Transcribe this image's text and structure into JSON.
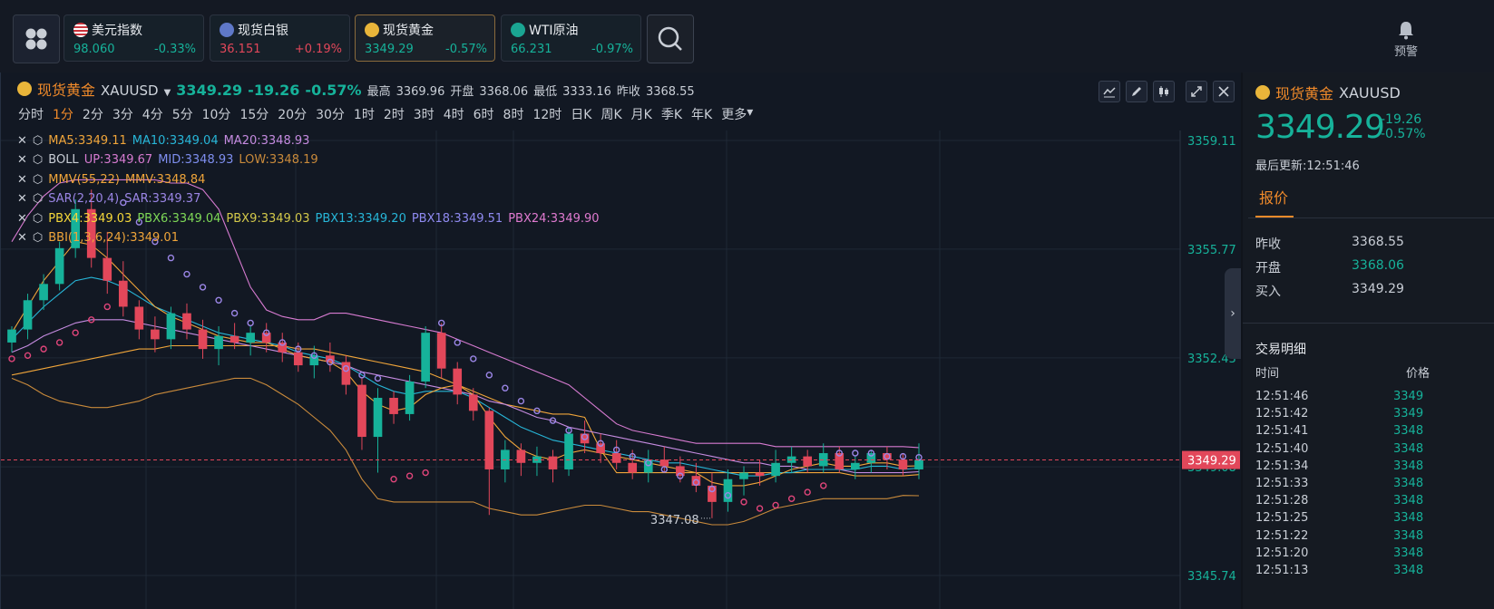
{
  "topbar": {
    "tickers": [
      {
        "name": "美元指数",
        "price": "98.060",
        "change": "-0.33%",
        "icon": "us-flag-icon"
      },
      {
        "name": "现货白银",
        "price": "36.151",
        "change": "+0.19%",
        "icon": "silver-icon"
      },
      {
        "name": "现货黄金",
        "price": "3349.29",
        "change": "-0.57%",
        "icon": "gold-icon"
      },
      {
        "name": "WTI原油",
        "price": "66.231",
        "change": "-0.97%",
        "icon": "oil-icon"
      }
    ],
    "alert_label": "预警"
  },
  "chart_header": {
    "name": "现货黄金",
    "code": "XAUUSD",
    "price": "3349.29",
    "change": "-19.26",
    "change_pct": "-0.57%",
    "high_label": "最高",
    "high": "3369.96",
    "open_label": "开盘",
    "open": "3368.06",
    "low_label": "最低",
    "low": "3333.16",
    "prev_label": "昨收",
    "prev": "3368.55"
  },
  "periods": [
    "分时",
    "1分",
    "2分",
    "3分",
    "4分",
    "5分",
    "10分",
    "15分",
    "20分",
    "30分",
    "1时",
    "2时",
    "3时",
    "4时",
    "6时",
    "8时",
    "12时",
    "日K",
    "周K",
    "月K",
    "季K",
    "年K",
    "更多"
  ],
  "selected_period": "1分",
  "indicators": [
    [
      {
        "t": "MA5:3349.11",
        "c": "#f0a53a"
      },
      {
        "t": "MA10:3349.04",
        "c": "#27b6d8"
      },
      {
        "t": "MA20:3348.93",
        "c": "#c58be0"
      }
    ],
    [
      {
        "t": "BOLL",
        "c": "#c9ced6"
      },
      {
        "t": "UP:3349.67",
        "c": "#d77bd1"
      },
      {
        "t": "MID:3348.93",
        "c": "#7f8ff0"
      },
      {
        "t": "LOW:3348.19",
        "c": "#c98a3b"
      }
    ],
    [
      {
        "t": "MMV(55,22)",
        "c": "#f0a53a"
      },
      {
        "t": "MMV:3348.84",
        "c": "#f0a53a"
      }
    ],
    [
      {
        "t": "SAR(2,20,4)",
        "c": "#9b86e6"
      },
      {
        "t": "SAR:3349.37",
        "c": "#9b86e6"
      }
    ],
    [
      {
        "t": "PBX4:3349.03",
        "c": "#f5d83a"
      },
      {
        "t": "PBX6:3349.04",
        "c": "#7ed957"
      },
      {
        "t": "PBX9:3349.03",
        "c": "#d4c94a"
      },
      {
        "t": "PBX13:3349.20",
        "c": "#27b6d8"
      },
      {
        "t": "PBX18:3349.51",
        "c": "#8f8af0"
      },
      {
        "t": "PBX24:3349.90",
        "c": "#e07ad0"
      }
    ],
    [
      {
        "t": "BBI(1,3,6,24):3349.01",
        "c": "#f0a53a"
      }
    ]
  ],
  "chart_data": {
    "type": "candlestick",
    "y_ticks": [
      "3359.11",
      "3355.77",
      "3352.43",
      "3349.08",
      "3345.74"
    ],
    "ylim": [
      3345.74,
      3359.11
    ],
    "last_price_tag": "3349.29",
    "min_label": "3347.08",
    "candles": [
      [
        3352.9,
        3353.4,
        3352.6,
        3353.3
      ],
      [
        3353.3,
        3354.4,
        3353.0,
        3354.2
      ],
      [
        3354.2,
        3355.0,
        3353.9,
        3354.7
      ],
      [
        3354.7,
        3356.0,
        3354.5,
        3355.8
      ],
      [
        3355.8,
        3357.3,
        3355.5,
        3357.0
      ],
      [
        3357.0,
        3357.6,
        3355.2,
        3355.5
      ],
      [
        3355.5,
        3356.3,
        3354.4,
        3354.8
      ],
      [
        3354.8,
        3355.4,
        3353.7,
        3354.0
      ],
      [
        3354.0,
        3354.2,
        3353.0,
        3353.3
      ],
      [
        3353.3,
        3353.7,
        3352.6,
        3353.0
      ],
      [
        3353.0,
        3354.0,
        3352.7,
        3353.8
      ],
      [
        3353.8,
        3354.1,
        3353.0,
        3353.3
      ],
      [
        3353.3,
        3353.6,
        3352.4,
        3352.7
      ],
      [
        3352.7,
        3353.4,
        3352.2,
        3353.1
      ],
      [
        3353.1,
        3353.5,
        3352.7,
        3352.9
      ],
      [
        3352.9,
        3353.4,
        3352.5,
        3353.2
      ],
      [
        3353.2,
        3353.5,
        3352.6,
        3352.9
      ],
      [
        3352.9,
        3353.2,
        3352.3,
        3352.6
      ],
      [
        3352.6,
        3352.9,
        3352.0,
        3352.2
      ],
      [
        3352.2,
        3352.8,
        3351.8,
        3352.5
      ],
      [
        3352.5,
        3352.9,
        3352.0,
        3352.3
      ],
      [
        3352.3,
        3352.5,
        3351.3,
        3351.6
      ],
      [
        3351.6,
        3351.8,
        3349.6,
        3350.0
      ],
      [
        3350.0,
        3351.5,
        3348.9,
        3351.2
      ],
      [
        3351.2,
        3351.4,
        3350.4,
        3350.7
      ],
      [
        3350.7,
        3351.9,
        3350.5,
        3351.7
      ],
      [
        3351.7,
        3353.4,
        3351.5,
        3353.2
      ],
      [
        3353.2,
        3353.5,
        3351.8,
        3352.1
      ],
      [
        3352.1,
        3352.3,
        3351.0,
        3351.3
      ],
      [
        3351.3,
        3351.5,
        3350.5,
        3350.8
      ],
      [
        3350.8,
        3350.9,
        3347.6,
        3349.0
      ],
      [
        3349.0,
        3349.9,
        3348.6,
        3349.6
      ],
      [
        3349.6,
        3349.8,
        3348.8,
        3349.2
      ],
      [
        3349.2,
        3349.7,
        3348.8,
        3349.4
      ],
      [
        3349.4,
        3349.6,
        3348.6,
        3349.0
      ],
      [
        3349.0,
        3350.3,
        3348.8,
        3350.1
      ],
      [
        3350.1,
        3350.5,
        3349.5,
        3349.8
      ],
      [
        3349.8,
        3350.1,
        3349.2,
        3349.5
      ],
      [
        3349.5,
        3349.9,
        3349.0,
        3349.2
      ],
      [
        3349.2,
        3349.6,
        3348.7,
        3348.9
      ],
      [
        3348.9,
        3349.6,
        3348.6,
        3349.3
      ],
      [
        3349.3,
        3349.7,
        3348.9,
        3349.1
      ],
      [
        3349.1,
        3349.4,
        3348.6,
        3348.8
      ],
      [
        3348.8,
        3349.2,
        3348.3,
        3348.5
      ],
      [
        3348.5,
        3348.9,
        3347.5,
        3348.0
      ],
      [
        3348.0,
        3349.0,
        3347.7,
        3348.7
      ],
      [
        3348.7,
        3349.1,
        3348.2,
        3348.9
      ],
      [
        3348.9,
        3349.3,
        3348.5,
        3348.8
      ],
      [
        3348.8,
        3349.6,
        3348.6,
        3349.2
      ],
      [
        3349.2,
        3349.7,
        3348.9,
        3349.4
      ],
      [
        3349.4,
        3349.6,
        3348.9,
        3349.1
      ],
      [
        3349.1,
        3349.8,
        3348.9,
        3349.5
      ],
      [
        3349.5,
        3349.7,
        3348.9,
        3349.0
      ],
      [
        3349.0,
        3349.4,
        3348.7,
        3349.2
      ],
      [
        3349.2,
        3349.6,
        3348.9,
        3349.5
      ],
      [
        3349.5,
        3349.7,
        3349.0,
        3349.3
      ],
      [
        3349.3,
        3349.5,
        3348.8,
        3349.0
      ],
      [
        3349.0,
        3349.8,
        3348.7,
        3349.29
      ]
    ],
    "lines": {
      "ma5": {
        "color": "#f0a53a",
        "values": [
          3353.2,
          3354.0,
          3354.8,
          3355.4,
          3356.0,
          3355.9,
          3355.5,
          3355.0,
          3354.5,
          3354.0,
          3353.7,
          3353.5,
          3353.3,
          3353.1,
          3353.0,
          3352.9,
          3352.9,
          3352.7,
          3352.5,
          3352.4,
          3352.3,
          3352.0,
          3351.4,
          3351.0,
          3350.8,
          3350.9,
          3351.3,
          3351.5,
          3351.6,
          3351.3,
          3350.6,
          3350.0,
          3349.6,
          3349.4,
          3349.3,
          3349.5,
          3349.6,
          3349.5,
          3349.4,
          3349.3,
          3349.2,
          3349.1,
          3349.0,
          3348.9,
          3348.6,
          3348.5,
          3348.5,
          3348.6,
          3348.8,
          3349.0,
          3349.1,
          3349.2,
          3349.1,
          3349.1,
          3349.2,
          3349.2,
          3349.1,
          3349.11
        ]
      },
      "ma10": {
        "color": "#27b6d8",
        "values": [
          3353.0,
          3353.5,
          3354.0,
          3354.4,
          3354.8,
          3354.9,
          3354.8,
          3354.6,
          3354.3,
          3354.0,
          3353.8,
          3353.6,
          3353.4,
          3353.2,
          3353.1,
          3353.0,
          3352.9,
          3352.8,
          3352.6,
          3352.5,
          3352.4,
          3352.2,
          3351.9,
          3351.6,
          3351.4,
          3351.3,
          3351.4,
          3351.4,
          3351.4,
          3351.2,
          3350.9,
          3350.6,
          3350.3,
          3350.1,
          3349.9,
          3349.8,
          3349.7,
          3349.6,
          3349.5,
          3349.4,
          3349.3,
          3349.2,
          3349.2,
          3349.1,
          3349.0,
          3348.9,
          3348.8,
          3348.8,
          3348.9,
          3348.9,
          3349.0,
          3349.0,
          3349.0,
          3349.0,
          3349.1,
          3349.1,
          3349.0,
          3349.04
        ]
      },
      "ma20": {
        "color": "#c58be0",
        "values": [
          3352.6,
          3352.8,
          3353.1,
          3353.3,
          3353.5,
          3353.6,
          3353.6,
          3353.6,
          3353.5,
          3353.4,
          3353.3,
          3353.2,
          3353.1,
          3353.0,
          3352.9,
          3352.8,
          3352.7,
          3352.6,
          3352.5,
          3352.4,
          3352.3,
          3352.2,
          3352.0,
          3351.9,
          3351.8,
          3351.7,
          3351.6,
          3351.5,
          3351.4,
          3351.3,
          3351.1,
          3351.0,
          3350.8,
          3350.6,
          3350.5,
          3350.3,
          3350.2,
          3350.1,
          3350.0,
          3349.9,
          3349.8,
          3349.7,
          3349.6,
          3349.5,
          3349.4,
          3349.3,
          3349.2,
          3349.2,
          3349.1,
          3349.1,
          3349.0,
          3349.0,
          3349.0,
          3348.9,
          3348.9,
          3348.9,
          3348.9,
          3348.93
        ]
      },
      "boll_up": {
        "color": "#d77bd1",
        "values": [
          3356.0,
          3356.8,
          3357.4,
          3357.8,
          3357.9,
          3357.9,
          3357.9,
          3357.9,
          3357.9,
          3357.9,
          3357.8,
          3357.8,
          3357.6,
          3357.0,
          3355.8,
          3354.6,
          3353.9,
          3353.7,
          3353.6,
          3353.6,
          3353.8,
          3353.8,
          3353.7,
          3353.6,
          3353.5,
          3353.4,
          3353.3,
          3353.2,
          3353.0,
          3352.8,
          3352.6,
          3352.4,
          3352.2,
          3352.0,
          3351.8,
          3351.6,
          3351.2,
          3350.8,
          3350.4,
          3350.2,
          3350.1,
          3350.0,
          3349.9,
          3349.8,
          3349.8,
          3349.8,
          3349.8,
          3349.8,
          3349.7,
          3349.7,
          3349.7,
          3349.7,
          3349.7,
          3349.7,
          3349.7,
          3349.7,
          3349.7,
          3349.67
        ]
      },
      "boll_low": {
        "color": "#c98a3b",
        "values": [
          3351.8,
          3351.6,
          3351.3,
          3351.1,
          3351.0,
          3350.9,
          3350.9,
          3351.0,
          3351.1,
          3351.3,
          3351.4,
          3351.5,
          3351.6,
          3351.7,
          3351.8,
          3351.8,
          3351.6,
          3351.3,
          3351.0,
          3350.6,
          3350.2,
          3349.6,
          3348.7,
          3348.1,
          3348.0,
          3348.0,
          3348.0,
          3348.0,
          3348.0,
          3348.0,
          3347.8,
          3347.7,
          3347.6,
          3347.6,
          3347.7,
          3347.8,
          3347.9,
          3347.9,
          3347.8,
          3347.7,
          3347.7,
          3347.6,
          3347.5,
          3347.4,
          3347.3,
          3347.3,
          3347.4,
          3347.6,
          3347.8,
          3347.9,
          3348.0,
          3348.1,
          3348.1,
          3348.1,
          3348.1,
          3348.1,
          3348.2,
          3348.19
        ]
      },
      "mmv": {
        "color": "#f0a53a",
        "values": [
          3351.9,
          3352.0,
          3352.1,
          3352.2,
          3352.3,
          3352.4,
          3352.5,
          3352.6,
          3352.7,
          3352.7,
          3352.8,
          3352.8,
          3352.8,
          3352.8,
          3352.8,
          3352.8,
          3352.8,
          3352.8,
          3352.7,
          3352.7,
          3352.6,
          3352.5,
          3352.4,
          3352.3,
          3352.2,
          3352.1,
          3352.0,
          3351.8,
          3351.6,
          3351.4,
          3351.2,
          3351.0,
          3350.9,
          3350.8,
          3350.7,
          3350.7,
          3350.6,
          3349.6,
          3348.9,
          3348.9,
          3348.9,
          3348.9,
          3348.9,
          3348.9,
          3348.9,
          3348.9,
          3348.9,
          3348.9,
          3348.9,
          3348.9,
          3348.9,
          3348.9,
          3348.9,
          3348.8,
          3348.8,
          3348.8,
          3348.8,
          3348.84
        ]
      }
    },
    "sar": [
      3352.4,
      3352.5,
      3352.7,
      3352.9,
      3353.2,
      3353.6,
      3354.0,
      3357.2,
      3356.6,
      3356.0,
      3355.5,
      3355.0,
      3354.6,
      3354.2,
      3353.8,
      3353.5,
      3353.2,
      3352.9,
      3352.7,
      3352.5,
      3352.3,
      3352.1,
      3351.9,
      3351.8,
      3348.7,
      3348.8,
      3348.9,
      3353.5,
      3352.9,
      3352.4,
      3351.9,
      3351.5,
      3351.1,
      3350.8,
      3350.5,
      3350.2,
      3350.0,
      3349.8,
      3349.6,
      3349.4,
      3349.2,
      3349.0,
      3348.8,
      3348.6,
      3348.4,
      3348.2,
      3348.0,
      3347.8,
      3347.9,
      3348.1,
      3348.3,
      3348.5,
      3349.5,
      3349.5,
      3349.5,
      3349.4,
      3349.4,
      3349.37
    ]
  },
  "right_panel": {
    "name": "现货黄金",
    "code": "XAUUSD",
    "price": "3349.29",
    "change": "-19.26",
    "change_pct": "-0.57%",
    "update_label": "最后更新:12:51:46",
    "tab": "报价",
    "quote": [
      {
        "k": "昨收",
        "v": "3368.55",
        "c": "#c9ced6"
      },
      {
        "k": "开盘",
        "v": "3368.06",
        "c": "#16b29a"
      },
      {
        "k": "买入",
        "v": "3349.29",
        "c": "#c9ced6"
      }
    ],
    "trades_title": "交易明细",
    "col_time": "时间",
    "col_price": "价格",
    "trades": [
      {
        "t": "12:51:46",
        "p": "3349"
      },
      {
        "t": "12:51:42",
        "p": "3349"
      },
      {
        "t": "12:51:41",
        "p": "3348"
      },
      {
        "t": "12:51:40",
        "p": "3348"
      },
      {
        "t": "12:51:34",
        "p": "3348"
      },
      {
        "t": "12:51:33",
        "p": "3348"
      },
      {
        "t": "12:51:28",
        "p": "3348"
      },
      {
        "t": "12:51:25",
        "p": "3348"
      },
      {
        "t": "12:51:22",
        "p": "3348"
      },
      {
        "t": "12:51:20",
        "p": "3348"
      },
      {
        "t": "12:51:13",
        "p": "3348"
      }
    ]
  }
}
